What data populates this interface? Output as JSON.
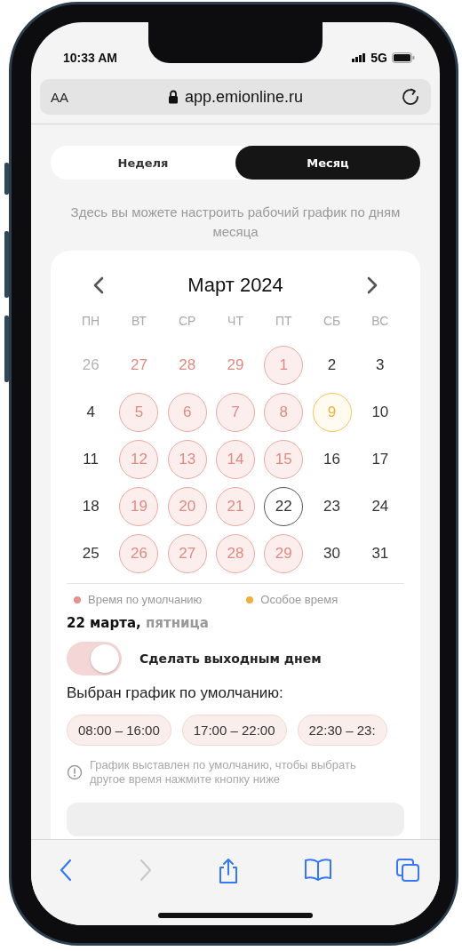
{
  "status_bar": {
    "time": "10:33 AM",
    "network": "5G"
  },
  "address_bar": {
    "text_size": "AA",
    "url": "app.emionline.ru"
  },
  "tabs": [
    {
      "label": "Неделя",
      "selected": false
    },
    {
      "label": "Месяц",
      "selected": true
    }
  ],
  "hint": "Здесь вы можете настроить рабочий график по дням месяца",
  "calendar": {
    "title": "Март 2024",
    "weekdays": [
      "ПН",
      "ВТ",
      "СР",
      "ЧТ",
      "ПТ",
      "СБ",
      "ВС"
    ],
    "days": [
      {
        "label": "26",
        "outside": true,
        "default_time": false,
        "special_time": false,
        "selected": false
      },
      {
        "label": "27",
        "outside": true,
        "default_time": true,
        "special_time": false,
        "selected": false
      },
      {
        "label": "28",
        "outside": true,
        "default_time": true,
        "special_time": false,
        "selected": false
      },
      {
        "label": "29",
        "outside": true,
        "default_time": true,
        "special_time": false,
        "selected": false
      },
      {
        "label": "1",
        "outside": false,
        "default_time": true,
        "special_time": false,
        "selected": false
      },
      {
        "label": "2",
        "outside": false,
        "default_time": false,
        "special_time": false,
        "selected": false
      },
      {
        "label": "3",
        "outside": false,
        "default_time": false,
        "special_time": false,
        "selected": false
      },
      {
        "label": "4",
        "outside": false,
        "default_time": false,
        "special_time": false,
        "selected": false
      },
      {
        "label": "5",
        "outside": false,
        "default_time": true,
        "special_time": false,
        "selected": false
      },
      {
        "label": "6",
        "outside": false,
        "default_time": true,
        "special_time": false,
        "selected": false
      },
      {
        "label": "7",
        "outside": false,
        "default_time": true,
        "special_time": false,
        "selected": false
      },
      {
        "label": "8",
        "outside": false,
        "default_time": true,
        "special_time": false,
        "selected": false
      },
      {
        "label": "9",
        "outside": false,
        "default_time": false,
        "special_time": true,
        "selected": false
      },
      {
        "label": "10",
        "outside": false,
        "default_time": false,
        "special_time": false,
        "selected": false
      },
      {
        "label": "11",
        "outside": false,
        "default_time": false,
        "special_time": false,
        "selected": false
      },
      {
        "label": "12",
        "outside": false,
        "default_time": true,
        "special_time": false,
        "selected": false
      },
      {
        "label": "13",
        "outside": false,
        "default_time": true,
        "special_time": false,
        "selected": false
      },
      {
        "label": "14",
        "outside": false,
        "default_time": true,
        "special_time": false,
        "selected": false
      },
      {
        "label": "15",
        "outside": false,
        "default_time": true,
        "special_time": false,
        "selected": false
      },
      {
        "label": "16",
        "outside": false,
        "default_time": false,
        "special_time": false,
        "selected": false
      },
      {
        "label": "17",
        "outside": false,
        "default_time": false,
        "special_time": false,
        "selected": false
      },
      {
        "label": "18",
        "outside": false,
        "default_time": false,
        "special_time": false,
        "selected": false
      },
      {
        "label": "19",
        "outside": false,
        "default_time": true,
        "special_time": false,
        "selected": false
      },
      {
        "label": "20",
        "outside": false,
        "default_time": true,
        "special_time": false,
        "selected": false
      },
      {
        "label": "21",
        "outside": false,
        "default_time": true,
        "special_time": false,
        "selected": false
      },
      {
        "label": "22",
        "outside": false,
        "default_time": false,
        "special_time": false,
        "selected": true
      },
      {
        "label": "23",
        "outside": false,
        "default_time": false,
        "special_time": false,
        "selected": false
      },
      {
        "label": "24",
        "outside": false,
        "default_time": false,
        "special_time": false,
        "selected": false
      },
      {
        "label": "25",
        "outside": false,
        "default_time": false,
        "special_time": false,
        "selected": false
      },
      {
        "label": "26",
        "outside": false,
        "default_time": true,
        "special_time": false,
        "selected": false
      },
      {
        "label": "27",
        "outside": false,
        "default_time": true,
        "special_time": false,
        "selected": false
      },
      {
        "label": "28",
        "outside": false,
        "default_time": true,
        "special_time": false,
        "selected": false
      },
      {
        "label": "29",
        "outside": false,
        "default_time": true,
        "special_time": false,
        "selected": false
      },
      {
        "label": "30",
        "outside": false,
        "default_time": false,
        "special_time": false,
        "selected": false
      },
      {
        "label": "31",
        "outside": false,
        "default_time": false,
        "special_time": false,
        "selected": false
      }
    ]
  },
  "legend": [
    {
      "label": "Время по умолчанию",
      "color": "#e8908c"
    },
    {
      "label": "Особое время",
      "color": "#f0b03c"
    }
  ],
  "day_title": "**22 марта,** пятница",
  "day_off": {
    "label": "Сделать выходным днем",
    "on": true
  },
  "schedule_title": "Выбран график по умолчанию:",
  "slots": [
    "08:00 – 16:00",
    "17:00 – 22:00",
    "22:30 – 23:"
  ],
  "info": "График выставлен по умолчанию, чтобы выбрать другое время нажмите кнопку ниже"
}
